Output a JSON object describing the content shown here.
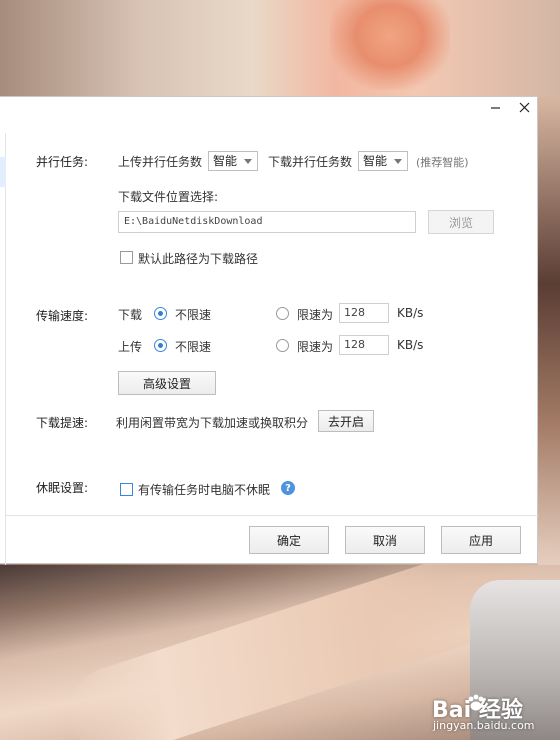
{
  "dialog": {
    "minimize_icon": "minimize-icon",
    "close_icon": "close-icon"
  },
  "parallel": {
    "label": "并行任务:",
    "upload_label": "上传并行任务数",
    "upload_value": "智能",
    "download_label": "下载并行任务数",
    "download_value": "智能",
    "hint": "(推荐智能)"
  },
  "download_location": {
    "label": "下载文件位置选择:",
    "path": "E:\\BaiduNetdiskDownload",
    "browse_label": "浏览",
    "default_checkbox_label": "默认此路径为下载路径",
    "default_checked": false
  },
  "speed": {
    "label": "传输速度:",
    "rows": [
      {
        "direction": "下载",
        "unlimited_label": "不限速",
        "unlimited_selected": true,
        "limit_label": "限速为",
        "limit_value": "128",
        "unit": "KB/s"
      },
      {
        "direction": "上传",
        "unlimited_label": "不限速",
        "unlimited_selected": true,
        "limit_label": "限速为",
        "limit_value": "128",
        "unit": "KB/s"
      }
    ],
    "advanced_label": "高级设置"
  },
  "boost": {
    "label": "下载提速:",
    "text": "利用闲置带宽为下载加速或换取积分",
    "button_label": "去开启"
  },
  "sleep": {
    "label": "休眠设置:",
    "checkbox_label": "有传输任务时电脑不休眠",
    "checked": false,
    "help_icon": "help-icon"
  },
  "footer": {
    "ok_label": "确定",
    "cancel_label": "取消",
    "apply_label": "应用"
  },
  "watermark": {
    "brand": "Bai  经验",
    "url": "jingyan.baidu.com"
  },
  "colors": {
    "accent": "#2f7fd6",
    "help": "#4f93df"
  }
}
